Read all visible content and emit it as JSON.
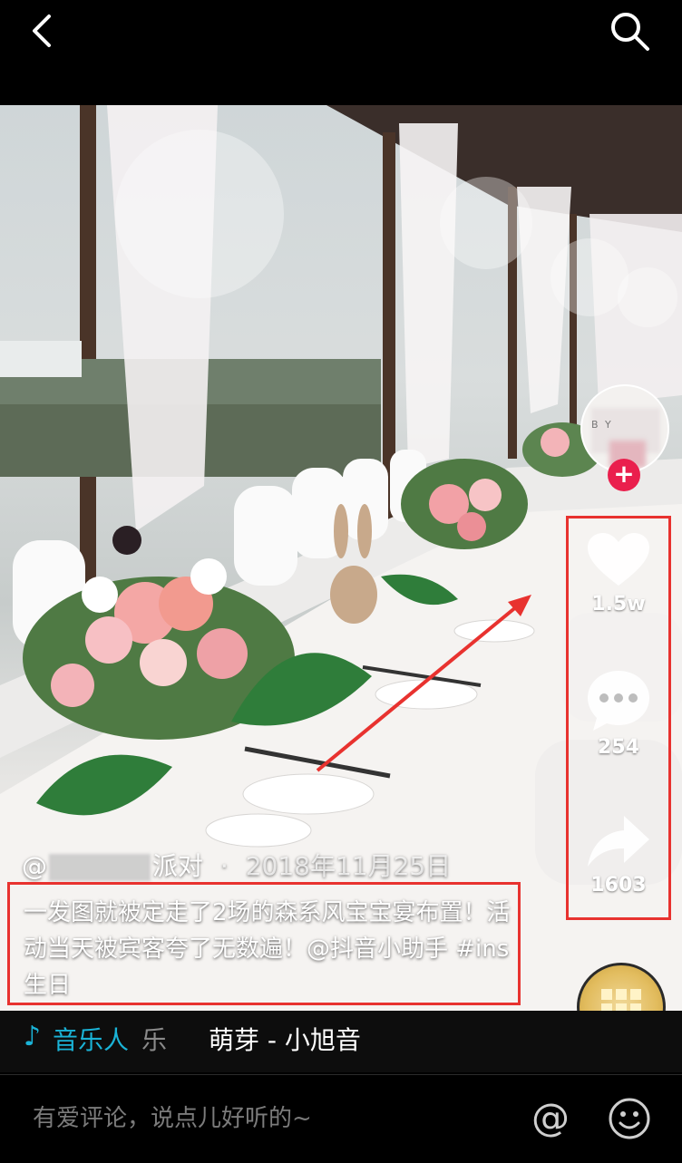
{
  "topbar": {
    "back_icon": "chevron-left-icon",
    "search_icon": "search-icon"
  },
  "video": {
    "author_prefix": "@",
    "author_visible": "派对",
    "author_separator": " · ",
    "date": "2018年11月25日",
    "caption": "一发图就被定走了2场的森系风宝宝宴布置！活动当天被宾客夸了无数遍！@抖音小助手 #ins生日"
  },
  "actions": {
    "like_count": "1.5w",
    "comment_count": "254",
    "share_count": "1603"
  },
  "avatar": {
    "blurred_text": "B      Y"
  },
  "follow": {
    "label": "+"
  },
  "music": {
    "note": "♪",
    "artist": "音乐人",
    "artist_cut": "乐",
    "title": "萌芽 - 小旭音"
  },
  "comment_bar": {
    "placeholder": "有爱评论，说点儿好听的~",
    "at_label": "@"
  },
  "colors": {
    "accent_red": "#e8322f",
    "follow_red": "#ea1f4d",
    "music_blue": "#1ab3d7"
  }
}
